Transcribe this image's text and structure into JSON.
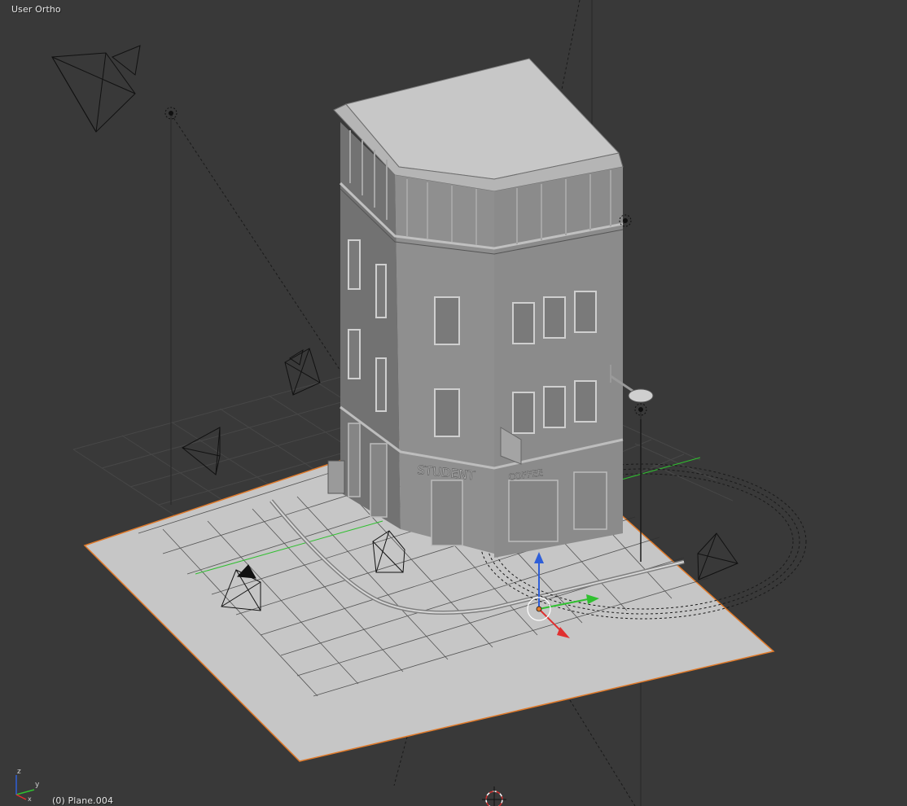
{
  "viewport": {
    "view_label": "User Ortho",
    "active_object_label": "(0) Plane.004",
    "background_color": "#393939"
  },
  "scene": {
    "building_sign_left": "STUDENT",
    "building_sign_right": "COFFEE",
    "objects": [
      {
        "name": "camera",
        "count": 6
      },
      {
        "name": "point-lamp",
        "count": 3
      },
      {
        "name": "street-lamp",
        "count": 1
      },
      {
        "name": "building",
        "count": 1
      },
      {
        "name": "ground-plane",
        "count": 1
      }
    ]
  },
  "gizmo": {
    "x_color": "#e03030",
    "y_color": "#30c030",
    "z_color": "#2f5fd8"
  },
  "axis_widget": {
    "x_label": "x",
    "y_label": "y",
    "z_label": "z"
  },
  "colors": {
    "grid_line": "#474747",
    "plane_fill": "#c6c6c6",
    "plane_edge": "#e07a2a",
    "building_light": "#9a9a9a",
    "building_dark": "#6d6d6d",
    "wire": "#111111"
  }
}
